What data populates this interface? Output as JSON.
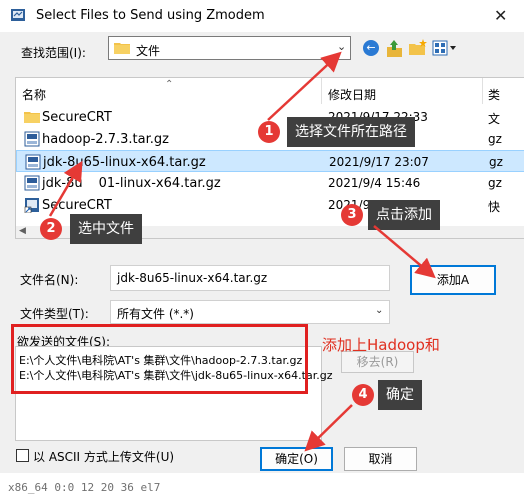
{
  "window": {
    "title": "Select Files to Send using Zmodem",
    "close_glyph": "✕"
  },
  "lookin": {
    "label": "查找范围(I):",
    "value": "文件",
    "nav_icons": [
      "back-icon",
      "up-folder-icon",
      "new-folder-icon",
      "view-menu-icon"
    ]
  },
  "list": {
    "headers": {
      "name": "名称",
      "date": "修改日期",
      "type": "类"
    },
    "rows": [
      {
        "name": "SecureCRT",
        "date": "2021/9/17 22:33",
        "type": "文",
        "icon": "folder-icon"
      },
      {
        "name": "hadoop-2.7.3.tar.gz",
        "date": "",
        "type": "gz",
        "icon": "archive-icon"
      },
      {
        "name": "jdk-8u65-linux-x64.tar.gz",
        "date": "2021/9/17 23:07",
        "type": "gz",
        "icon": "archive-icon",
        "selected": true
      },
      {
        "name": "jdk-8u",
        "date": "2021/9/4 15:46",
        "type": "gz",
        "icon": "archive-icon",
        "name_tail": "01-linux-x64.tar.gz"
      },
      {
        "name": "SecureCRT",
        "date": "2021/9/17 22:33",
        "type": "快",
        "icon": "shortcut-icon"
      }
    ]
  },
  "form": {
    "filename_label": "文件名(N):",
    "filename_value": "jdk-8u65-linux-x64.tar.gz",
    "filetype_label": "文件类型(T):",
    "filetype_value": "所有文件 (*.*)",
    "add_label": "添加A",
    "send_list_label": "欲发送的文件(S):",
    "send_items": [
      "E:\\个人文件\\电科院\\AT's 集群\\文件\\hadoop-2.7.3.tar.gz",
      "E:\\个人文件\\电科院\\AT's 集群\\文件\\jdk-8u65-linux-x64.tar.gz"
    ],
    "remove_label": "移去(R)",
    "ascii_label": "以 ASCII 方式上传文件(U)",
    "ok_label": "确定(O)",
    "cancel_label": "取消"
  },
  "terminal": {
    "text": "x86_64 0:0 12 20 36 el7"
  },
  "annotations": {
    "step1": {
      "num": "1",
      "text": "选择文件所在路径"
    },
    "step2": {
      "num": "2",
      "text": "选中文件"
    },
    "step3": {
      "num": "3",
      "text": "点击添加"
    },
    "step4": {
      "num": "4",
      "text": "确定"
    },
    "note": "添加上Hadoop和",
    "color": "#e53935"
  }
}
